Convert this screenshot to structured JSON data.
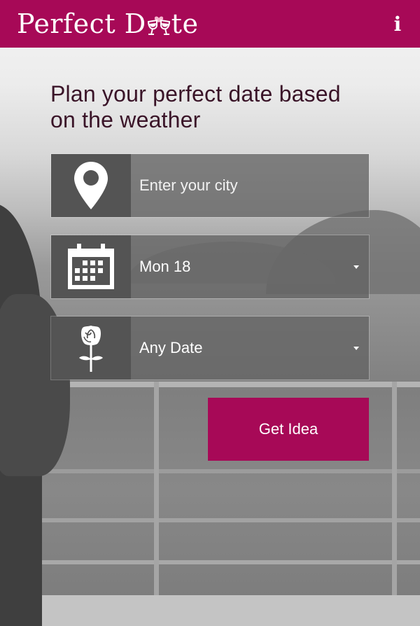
{
  "header": {
    "logo_part1": "Perfect D",
    "logo_part2": "te",
    "info_label": "i"
  },
  "main": {
    "headline": "Plan your perfect date based on the weather"
  },
  "form": {
    "city": {
      "placeholder": "Enter your city",
      "value": "",
      "icon": "location-pin-icon"
    },
    "date": {
      "value": "Mon 18",
      "icon": "calendar-icon"
    },
    "date_type": {
      "value": "Any Date",
      "icon": "rose-icon"
    },
    "submit_label": "Get Idea"
  },
  "colors": {
    "brand": "#a70957",
    "icon_box": "#545454",
    "field_bg": "#646464",
    "headline": "#3a1428"
  }
}
